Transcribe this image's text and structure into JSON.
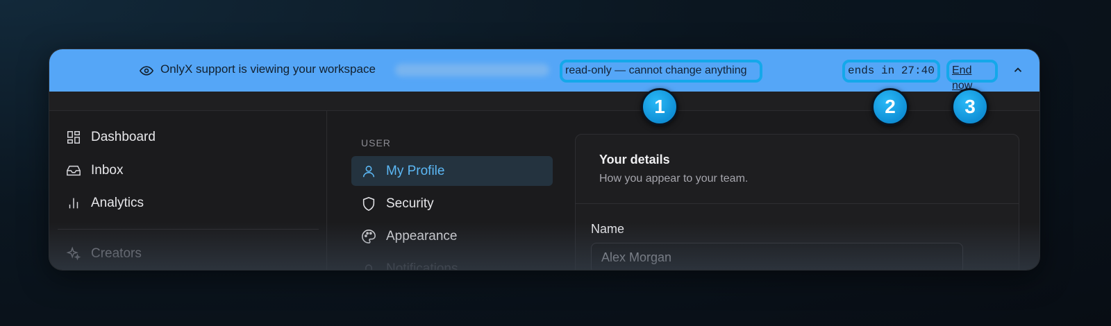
{
  "banner": {
    "message": "OnlyX support is viewing your workspace",
    "readonly_label": "read-only — cannot change anything",
    "timer": "ends in 27:40",
    "end_label": "End now",
    "color": "#55a6f7"
  },
  "sidebar": {
    "items": [
      {
        "label": "Dashboard",
        "icon": "grid-icon"
      },
      {
        "label": "Inbox",
        "icon": "inbox-icon"
      },
      {
        "label": "Analytics",
        "icon": "bar-chart-icon"
      },
      {
        "label": "Creators",
        "icon": "sparkles-icon"
      }
    ]
  },
  "settings": {
    "section_label": "USER",
    "items": [
      {
        "label": "My Profile",
        "icon": "user-icon",
        "active": true
      },
      {
        "label": "Security",
        "icon": "shield-icon"
      },
      {
        "label": "Appearance",
        "icon": "palette-icon"
      },
      {
        "label": "Notifications",
        "icon": "bell-icon"
      }
    ]
  },
  "card": {
    "title": "Your details",
    "description": "How you appear to your team.",
    "name_label": "Name",
    "name_value": "Alex Morgan"
  },
  "callouts": [
    "1",
    "2",
    "3"
  ],
  "colors": {
    "accent": "#5cb8f5",
    "callout": "#14a8ea"
  }
}
